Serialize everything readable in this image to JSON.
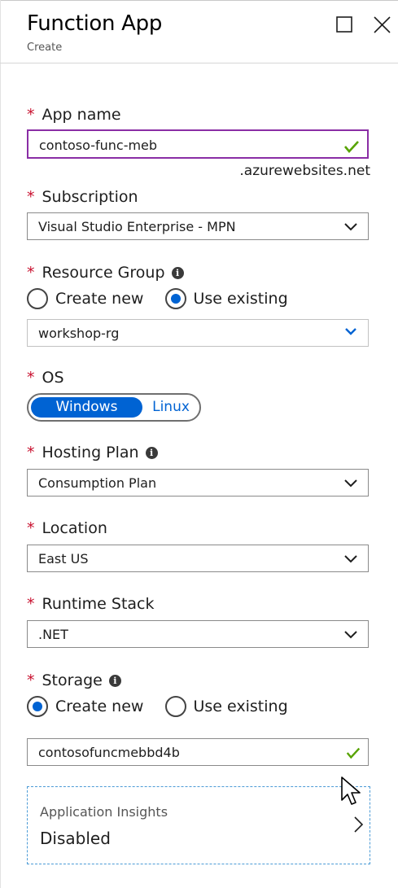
{
  "header": {
    "title": "Function App",
    "subtitle": "Create",
    "maximize_icon": "square-icon",
    "close_icon": "close-icon"
  },
  "app_name": {
    "label": "App name",
    "value": "contoso-func-meb",
    "suffix": ".azurewebsites.net",
    "valid": true
  },
  "subscription": {
    "label": "Subscription",
    "value": "Visual Studio Enterprise - MPN"
  },
  "resource_group": {
    "label": "Resource Group",
    "options": [
      "Create new",
      "Use existing"
    ],
    "selected": "Use existing",
    "value": "workshop-rg"
  },
  "os": {
    "label": "OS",
    "options": [
      "Windows",
      "Linux"
    ],
    "selected": "Windows"
  },
  "hosting_plan": {
    "label": "Hosting Plan",
    "value": "Consumption Plan"
  },
  "location": {
    "label": "Location",
    "value": "East US"
  },
  "runtime_stack": {
    "label": "Runtime Stack",
    "value": ".NET"
  },
  "storage": {
    "label": "Storage",
    "options": [
      "Create new",
      "Use existing"
    ],
    "selected": "Create new",
    "value": "contosofuncmebbd4b",
    "valid": true
  },
  "app_insights": {
    "title": "Application Insights",
    "value": "Disabled"
  },
  "required_marker": "*",
  "colors": {
    "accent": "#0063d3",
    "required": "#c8102e",
    "focus_border": "#8a2da5",
    "valid_check": "#57a300"
  }
}
